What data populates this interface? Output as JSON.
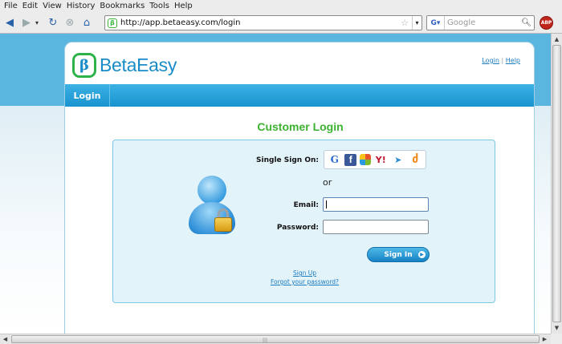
{
  "menu": [
    "File",
    "Edit",
    "View",
    "History",
    "Bookmarks",
    "Tools",
    "Help"
  ],
  "toolbar": {
    "back_icon": "back-arrow-icon",
    "forward_icon": "forward-arrow-icon",
    "reload_icon": "reload-icon",
    "stop_icon": "stop-icon",
    "home_icon": "home-icon",
    "url": "http://app.betaeasy.com/login",
    "search_placeholder": "Google",
    "adblock_label": "ABP"
  },
  "site": {
    "logo_mark": "β",
    "logo_text": "BetaEasy",
    "top_links": {
      "login": "Login",
      "separator": "|",
      "help": "Help"
    },
    "nav_login": "Login"
  },
  "login": {
    "title": "Customer Login",
    "sso_label": "Single Sign On:",
    "sso_providers": [
      "Google",
      "Facebook",
      "Windows Live",
      "Yahoo",
      "AIM",
      "OpenID"
    ],
    "or": "or",
    "email_label": "Email:",
    "password_label": "Password:",
    "email_value": "",
    "password_value": "",
    "signin_label": "Sign In",
    "signup_link": "Sign Up",
    "forgot_link": "Forgot your password?"
  },
  "colors": {
    "brand_blue": "#1a8cc8",
    "brand_green": "#2db34a",
    "title_green": "#3db231",
    "nav_blue": "#1893cf"
  }
}
